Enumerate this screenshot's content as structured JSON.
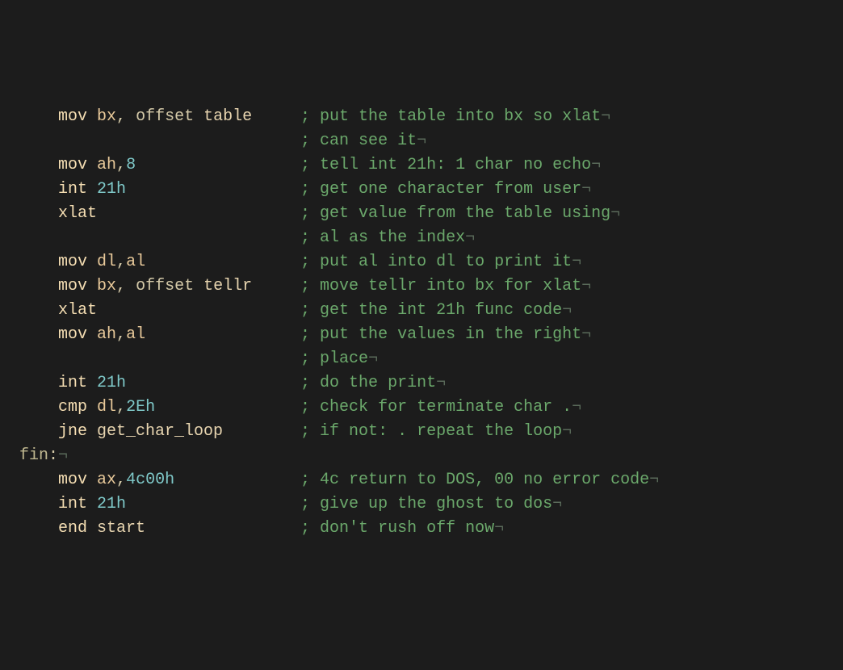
{
  "code_lines": [
    {
      "indent": "code",
      "code_tokens": [
        {
          "type": "mnemonic",
          "text": "mov"
        },
        {
          "type": "space",
          "text": " "
        },
        {
          "type": "register",
          "text": "bx"
        },
        {
          "type": "comma",
          "text": ","
        },
        {
          "type": "space",
          "text": " "
        },
        {
          "type": "keyword",
          "text": "offset"
        },
        {
          "type": "space",
          "text": " "
        },
        {
          "type": "identifier",
          "text": "table"
        },
        {
          "type": "space",
          "text": "  "
        }
      ],
      "comment": "; put the table into bx so xlat",
      "eol": "¬"
    },
    {
      "indent": "full",
      "code_tokens": [],
      "comment": "; can see it",
      "eol": "¬"
    },
    {
      "indent": "code",
      "code_tokens": [
        {
          "type": "mnemonic",
          "text": "mov"
        },
        {
          "type": "space",
          "text": " "
        },
        {
          "type": "register",
          "text": "ah"
        },
        {
          "type": "comma",
          "text": ","
        },
        {
          "type": "number",
          "text": "8"
        }
      ],
      "comment": "; tell int 21h: 1 char no echo",
      "eol": "¬"
    },
    {
      "indent": "code",
      "code_tokens": [
        {
          "type": "mnemonic",
          "text": "int"
        },
        {
          "type": "space",
          "text": " "
        },
        {
          "type": "number",
          "text": "21h"
        }
      ],
      "comment": "; get one character from user",
      "eol": "¬"
    },
    {
      "indent": "code",
      "code_tokens": [
        {
          "type": "mnemonic",
          "text": "xlat"
        }
      ],
      "comment": "; get value from the table using",
      "eol": "¬"
    },
    {
      "indent": "full",
      "code_tokens": [],
      "comment": "; al as the index",
      "eol": "¬"
    },
    {
      "indent": "code",
      "code_tokens": [
        {
          "type": "mnemonic",
          "text": "mov"
        },
        {
          "type": "space",
          "text": " "
        },
        {
          "type": "register",
          "text": "dl"
        },
        {
          "type": "comma",
          "text": ","
        },
        {
          "type": "register",
          "text": "al"
        }
      ],
      "comment": "; put al into dl to print it",
      "eol": "¬"
    },
    {
      "indent": "code",
      "code_tokens": [
        {
          "type": "mnemonic",
          "text": "mov"
        },
        {
          "type": "space",
          "text": " "
        },
        {
          "type": "register",
          "text": "bx"
        },
        {
          "type": "comma",
          "text": ","
        },
        {
          "type": "space",
          "text": " "
        },
        {
          "type": "keyword",
          "text": "offset"
        },
        {
          "type": "space",
          "text": " "
        },
        {
          "type": "identifier",
          "text": "tellr"
        },
        {
          "type": "space",
          "text": "  "
        }
      ],
      "comment": "; move tellr into bx for xlat",
      "eol": "¬"
    },
    {
      "indent": "code",
      "code_tokens": [
        {
          "type": "mnemonic",
          "text": "xlat"
        }
      ],
      "comment": "; get the int 21h func code",
      "eol": "¬"
    },
    {
      "indent": "code",
      "code_tokens": [
        {
          "type": "mnemonic",
          "text": "mov"
        },
        {
          "type": "space",
          "text": " "
        },
        {
          "type": "register",
          "text": "ah"
        },
        {
          "type": "comma",
          "text": ","
        },
        {
          "type": "register",
          "text": "al"
        }
      ],
      "comment": "; put the values in the right",
      "eol": "¬"
    },
    {
      "indent": "full",
      "code_tokens": [],
      "comment": "; place",
      "eol": "¬"
    },
    {
      "indent": "code",
      "code_tokens": [
        {
          "type": "mnemonic",
          "text": "int"
        },
        {
          "type": "space",
          "text": " "
        },
        {
          "type": "number",
          "text": "21h"
        }
      ],
      "comment": "; do the print",
      "eol": "¬"
    },
    {
      "indent": "code",
      "code_tokens": [
        {
          "type": "mnemonic",
          "text": "cmp"
        },
        {
          "type": "space",
          "text": " "
        },
        {
          "type": "register",
          "text": "dl"
        },
        {
          "type": "comma",
          "text": ","
        },
        {
          "type": "number",
          "text": "2Eh"
        }
      ],
      "comment": "; check for terminate char .",
      "eol": "¬"
    },
    {
      "indent": "code",
      "code_tokens": [
        {
          "type": "mnemonic",
          "text": "jne"
        },
        {
          "type": "space",
          "text": " "
        },
        {
          "type": "identifier",
          "text": "get_char_loop"
        },
        {
          "type": "space",
          "text": "   "
        }
      ],
      "comment": "; if not: . repeat the loop",
      "eol": "¬"
    },
    {
      "indent": "label",
      "code_tokens": [
        {
          "type": "label",
          "text": "fin"
        },
        {
          "type": "colon",
          "text": ":"
        }
      ],
      "comment": null,
      "eol": "¬"
    },
    {
      "indent": "code",
      "code_tokens": [
        {
          "type": "mnemonic",
          "text": "mov"
        },
        {
          "type": "space",
          "text": " "
        },
        {
          "type": "register",
          "text": "ax"
        },
        {
          "type": "comma",
          "text": ","
        },
        {
          "type": "number",
          "text": "4c00h"
        }
      ],
      "comment": "; 4c return to DOS, 00 no error code",
      "eol": "¬"
    },
    {
      "indent": "code",
      "code_tokens": [
        {
          "type": "mnemonic",
          "text": "int"
        },
        {
          "type": "space",
          "text": " "
        },
        {
          "type": "number",
          "text": "21h"
        }
      ],
      "comment": "; give up the ghost to dos",
      "eol": "¬"
    },
    {
      "indent": "code",
      "code_tokens": [
        {
          "type": "mnemonic",
          "text": "end"
        },
        {
          "type": "space",
          "text": " "
        },
        {
          "type": "identifier",
          "text": "start"
        }
      ],
      "comment": "; don't rush off now",
      "eol": "¬"
    }
  ]
}
